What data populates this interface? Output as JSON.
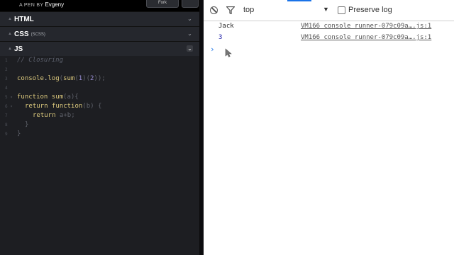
{
  "codepen": {
    "pen_by": "A PEN BY",
    "author": "Evgeny",
    "fork_label": "Fork",
    "panels": [
      {
        "name": "HTML",
        "sub": ""
      },
      {
        "name": "CSS",
        "sub": "(SCSS)"
      },
      {
        "name": "JS",
        "sub": ""
      }
    ],
    "code": {
      "line1_comment": "// Closuring",
      "line3_console": "console",
      "line3_dot": ".",
      "line3_log": "log",
      "line3_open": "(",
      "line3_sum": "sum",
      "line3_args1": "(",
      "line3_one": "1",
      "line3_mid": ")(",
      "line3_two": "2",
      "line3_end": "));",
      "line5_kw": "function",
      "line5_name": " sum",
      "line5_params": "(a){",
      "line6_return": "return",
      "line6_fn": " function",
      "line6_params": "(b) {",
      "line7_return": "return",
      "line7_expr": " a+b;",
      "line8": "}",
      "line9": "}"
    }
  },
  "console": {
    "context": "top",
    "preserve_log_label": "Preserve log",
    "preserve_log_checked": false,
    "messages": [
      {
        "value": "Jack",
        "source": "VM166 console_runner-079c09a….js:1",
        "is_number": false
      },
      {
        "value": "3",
        "source": "VM166 console_runner-079c09a….js:1",
        "is_number": true
      }
    ],
    "prompt": "›"
  },
  "colors": {
    "editor_bg": "#1d1e22",
    "keyword": "#ddca7e",
    "number": "#9a8fd6",
    "devtools_accent": "#1a73e8"
  }
}
